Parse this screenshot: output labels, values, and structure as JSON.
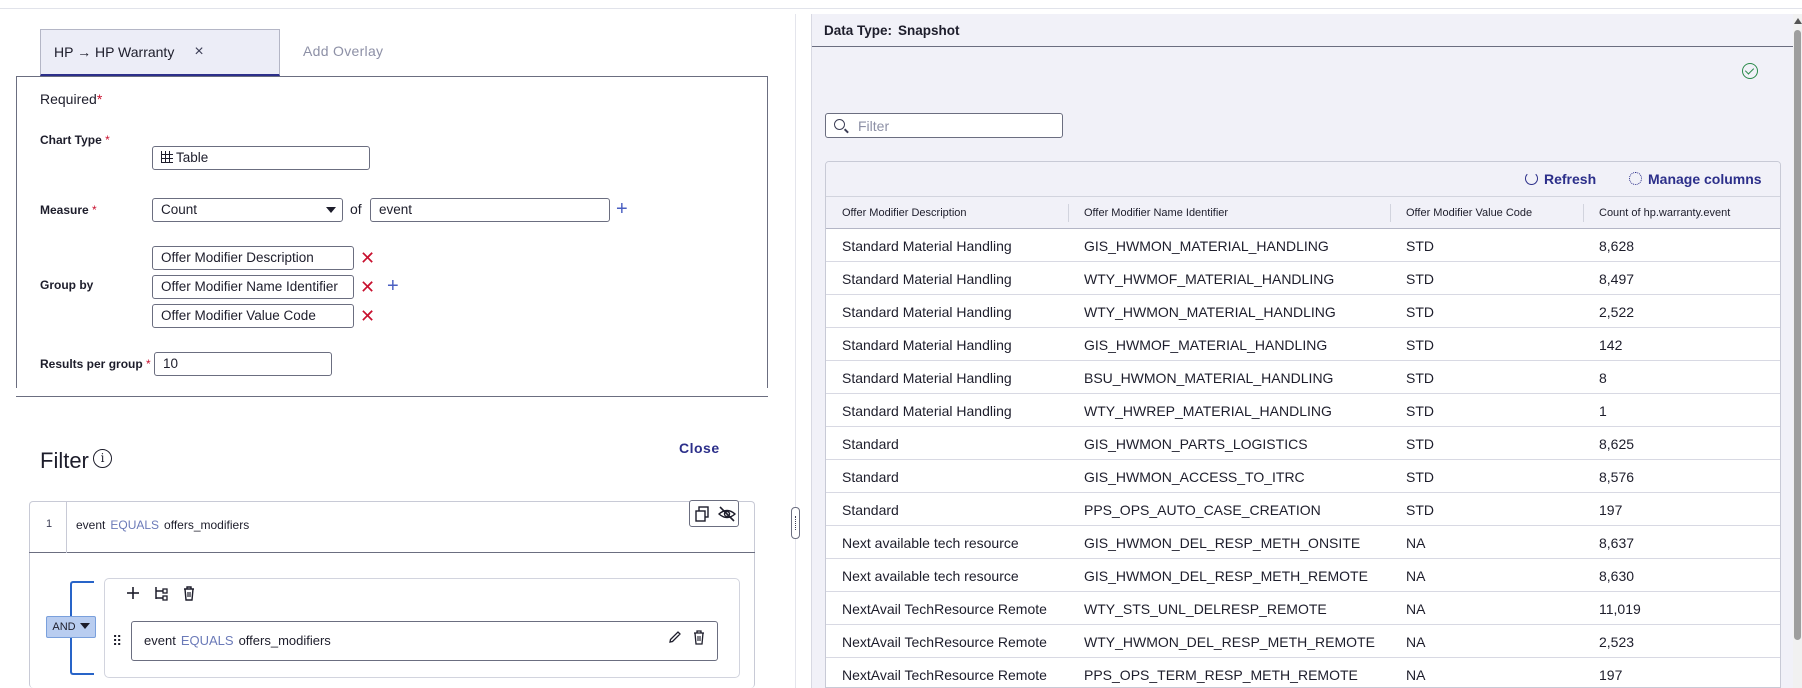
{
  "overlay_tabs": {
    "active_label": "HP → HP Warranty",
    "close_glyph": "×",
    "add_label": "Add Overlay"
  },
  "required_section": {
    "title": "Required",
    "star": "*",
    "chart_type": {
      "label": "Chart Type",
      "value": "Table",
      "icon": "table-icon"
    },
    "measure": {
      "label": "Measure",
      "selected": "Count",
      "of_label": "of",
      "field": "event"
    },
    "group_by": {
      "label": "Group by",
      "fields": [
        "Offer Modifier Description",
        "Offer Modifier Name Identifier",
        "Offer Modifier Value Code"
      ]
    },
    "results_per_group": {
      "label": "Results per group",
      "value": "10"
    }
  },
  "filter_section": {
    "title": "Filter",
    "close_label": "Close",
    "rule": {
      "index": "1",
      "field": "event",
      "operator": "EQUALS",
      "value": "offers_modifiers"
    },
    "group": {
      "logic": "AND",
      "condition": {
        "field": "event",
        "operator": "EQUALS",
        "value": "offers_modifiers"
      }
    }
  },
  "data_panel": {
    "data_type_label": "Data Type:",
    "data_type_value": "Snapshot",
    "filter_placeholder": "Filter",
    "refresh_label": "Refresh",
    "manage_columns_label": "Manage columns",
    "columns": [
      "Offer Modifier Description",
      "Offer Modifier Name Identifier",
      "Offer Modifier Value Code",
      "Count of hp.warranty.event"
    ],
    "rows": [
      [
        "Standard Material Handling",
        "GIS_HWMON_MATERIAL_HANDLING",
        "STD",
        "8,628"
      ],
      [
        "Standard Material Handling",
        "WTY_HWMOF_MATERIAL_HANDLING",
        "STD",
        "8,497"
      ],
      [
        "Standard Material Handling",
        "WTY_HWMON_MATERIAL_HANDLING",
        "STD",
        "2,522"
      ],
      [
        "Standard Material Handling",
        "GIS_HWMOF_MATERIAL_HANDLING",
        "STD",
        "142"
      ],
      [
        "Standard Material Handling",
        "BSU_HWMON_MATERIAL_HANDLING",
        "STD",
        "8"
      ],
      [
        "Standard Material Handling",
        "WTY_HWREP_MATERIAL_HANDLING",
        "STD",
        "1"
      ],
      [
        "Standard",
        "GIS_HWMON_PARTS_LOGISTICS",
        "STD",
        "8,625"
      ],
      [
        "Standard",
        "GIS_HWMON_ACCESS_TO_ITRC",
        "STD",
        "8,576"
      ],
      [
        "Standard",
        "PPS_OPS_AUTO_CASE_CREATION",
        "STD",
        "197"
      ],
      [
        "Next available tech resource",
        "GIS_HWMON_DEL_RESP_METH_ONSITE",
        "NA",
        "8,637"
      ],
      [
        "Next available tech resource",
        "GIS_HWMON_DEL_RESP_METH_REMOTE",
        "NA",
        "8,630"
      ],
      [
        "NextAvail TechResource Remote",
        "WTY_STS_UNL_DELRESP_REMOTE",
        "NA",
        "11,019"
      ],
      [
        "NextAvail TechResource Remote",
        "WTY_HWMON_DEL_RESP_METH_REMOTE",
        "NA",
        "2,523"
      ],
      [
        "NextAvail TechResource Remote",
        "PPS_OPS_TERM_RESP_METH_REMOTE",
        "NA",
        "197"
      ]
    ]
  },
  "colors": {
    "accent": "#2c2f8a",
    "link_blue": "#4a5fc1",
    "danger": "#c8102e",
    "and_chip": "#b9cdf0",
    "panel_bg": "#f1f1f8"
  }
}
